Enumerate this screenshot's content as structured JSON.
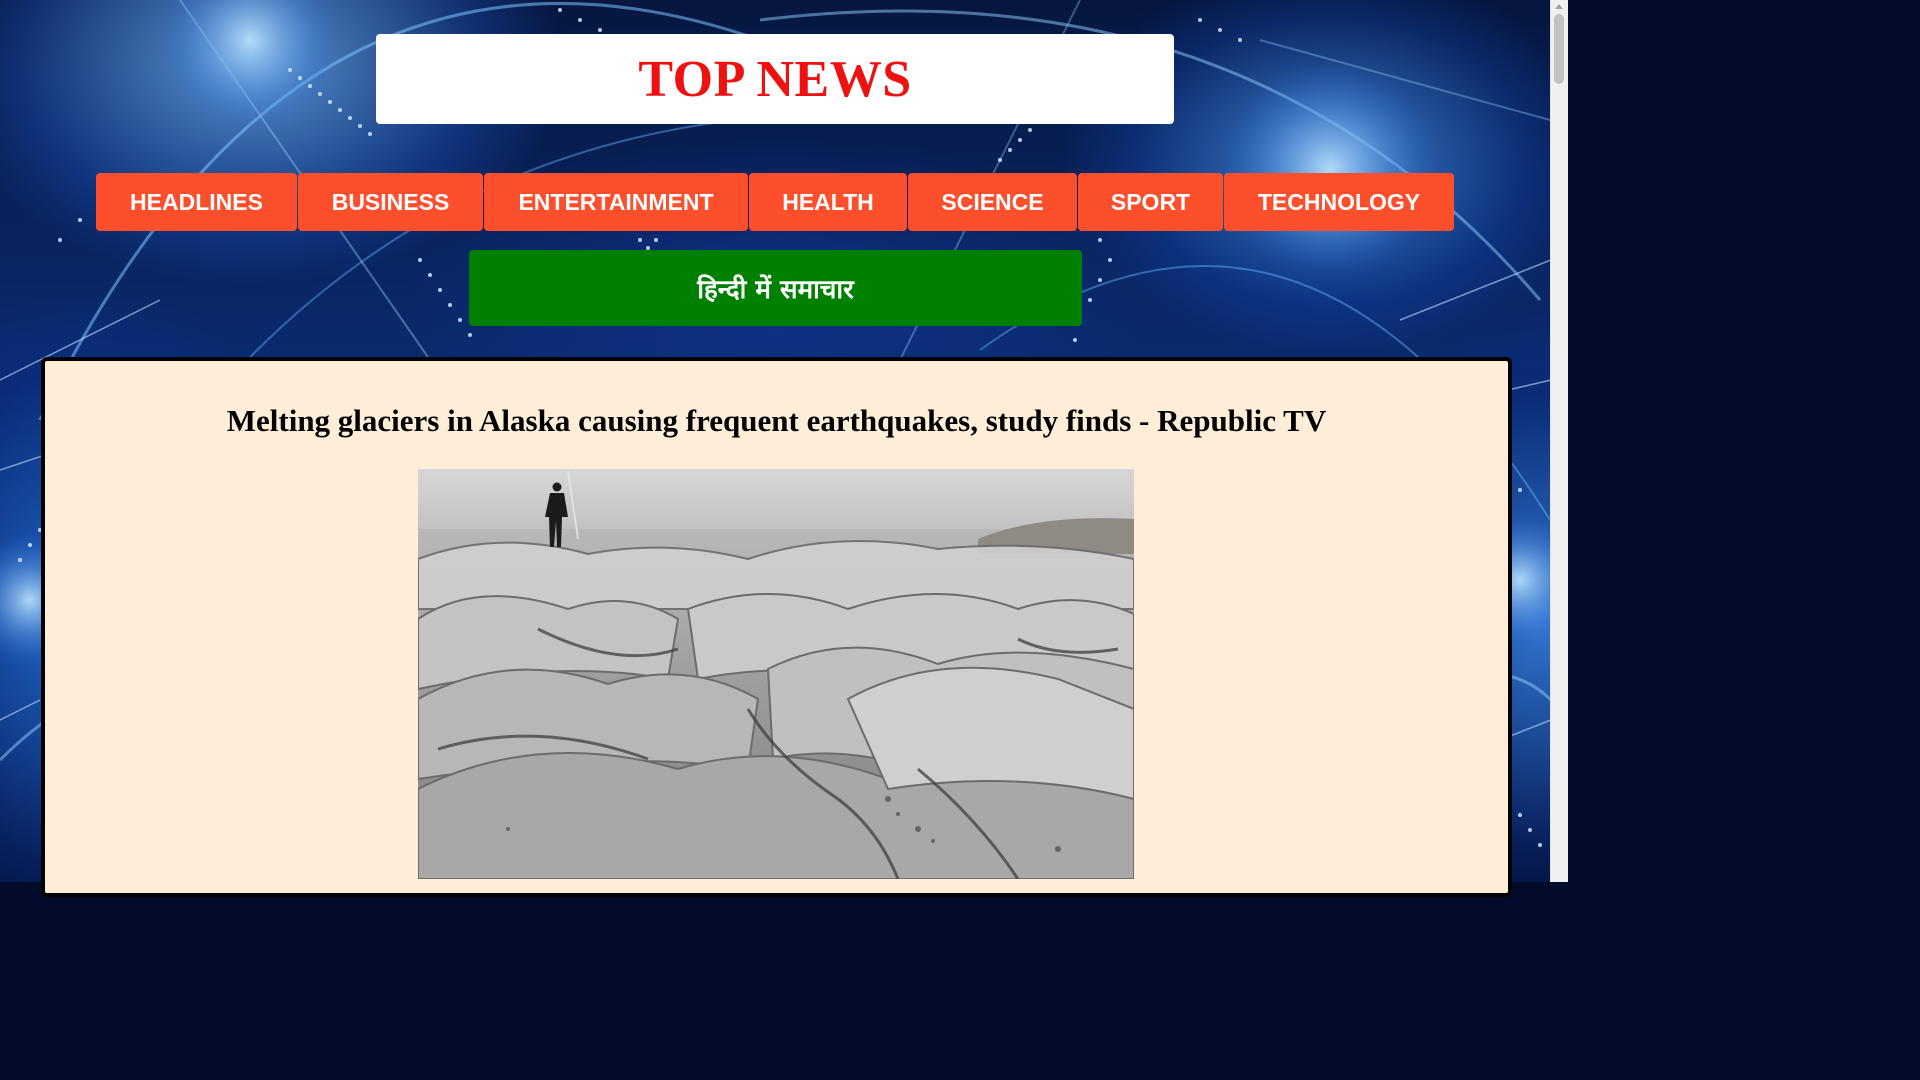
{
  "header": {
    "title": "TOP NEWS",
    "title_color": "#ee1111"
  },
  "nav": {
    "items": [
      {
        "label": "HEADLINES"
      },
      {
        "label": "BUSINESS"
      },
      {
        "label": "ENTERTAINMENT"
      },
      {
        "label": "HEALTH"
      },
      {
        "label": "SCIENCE"
      },
      {
        "label": "SPORT"
      },
      {
        "label": "TECHNOLOGY"
      }
    ],
    "button_color": "#fe4f2c"
  },
  "hindi_button": {
    "label": "हिन्दी में समाचार",
    "color": "#008000"
  },
  "article": {
    "headline": "Melting glaciers in Alaska causing frequent earthquakes, study finds - Republic TV",
    "card_color": "#feeed7",
    "image_icon": "glacier-photo"
  },
  "background": {
    "icon": "digital-globe-background"
  }
}
